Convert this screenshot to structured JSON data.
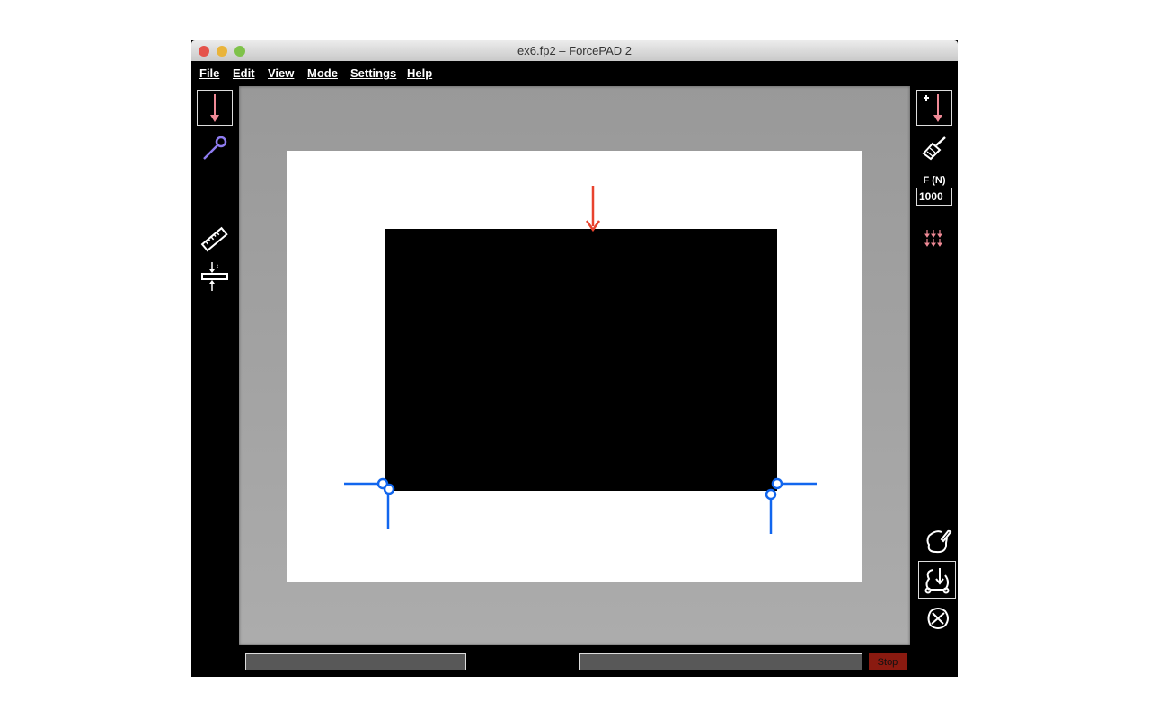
{
  "window": {
    "title": "ex6.fp2 – ForcePAD 2"
  },
  "menu": [
    "File",
    "Edit",
    "View",
    "Mode",
    "Settings",
    "Help"
  ],
  "left_tools": [
    "force-tool",
    "constraint-tool",
    "measure-tool",
    "thickness-tool"
  ],
  "right_panel": {
    "force_label": "F (N)",
    "force_value": "1000"
  },
  "status": {
    "stop_label": "Stop",
    "left_field": "",
    "right_field": ""
  },
  "colors": {
    "force": "#e8432e",
    "support": "#1166ee",
    "accent_pink": "#f08a96",
    "constraint": "#8f7cf0"
  }
}
